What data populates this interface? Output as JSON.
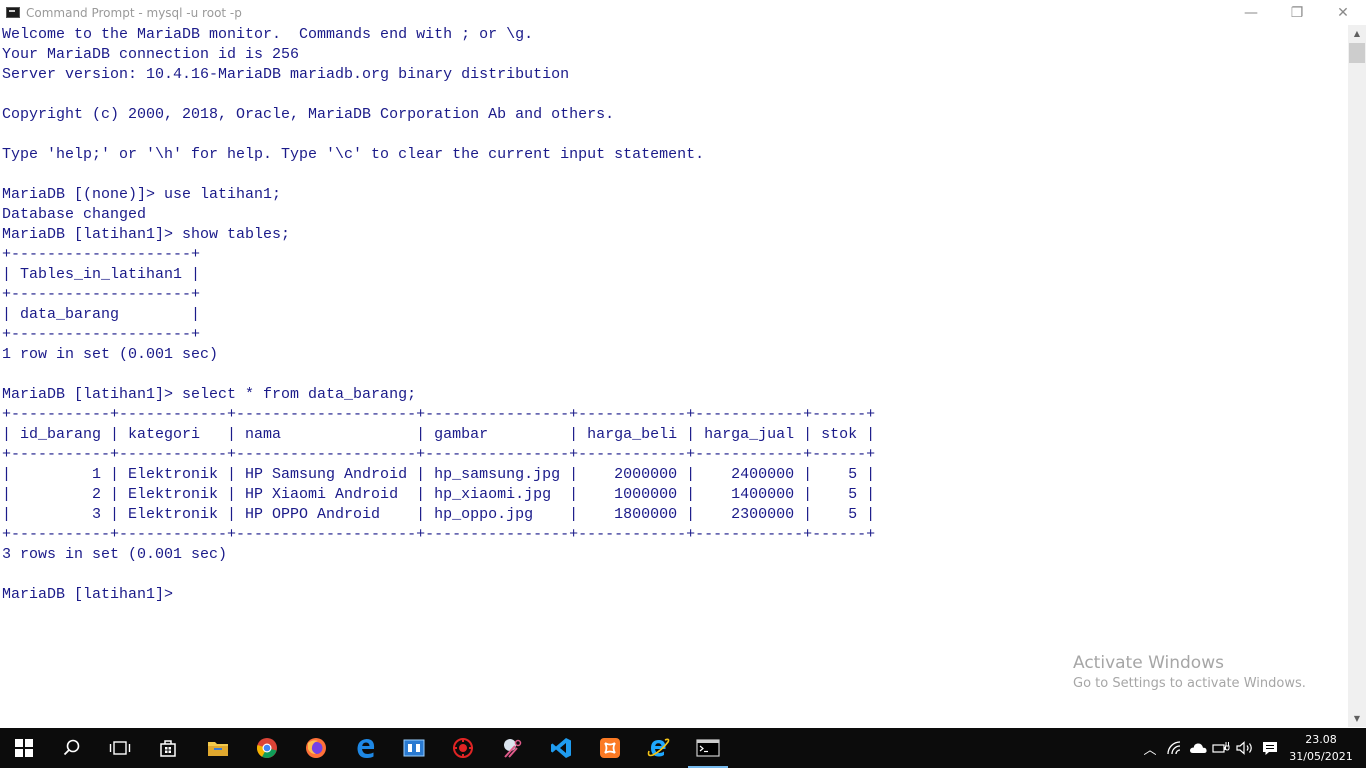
{
  "window": {
    "title": "Command Prompt - mysql  -u root -p",
    "minimize_glyph": "—",
    "restore_glyph": "❐",
    "close_glyph": "✕"
  },
  "console": {
    "lines": [
      "Welcome to the MariaDB monitor.  Commands end with ; or \\g.",
      "Your MariaDB connection id is 256",
      "Server version: 10.4.16-MariaDB mariadb.org binary distribution",
      "",
      "Copyright (c) 2000, 2018, Oracle, MariaDB Corporation Ab and others.",
      "",
      "Type 'help;' or '\\h' for help. Type '\\c' to clear the current input statement.",
      "",
      "MariaDB [(none)]> use latihan1;",
      "Database changed",
      "MariaDB [latihan1]> show tables;",
      "+--------------------+",
      "| Tables_in_latihan1 |",
      "+--------------------+",
      "| data_barang        |",
      "+--------------------+",
      "1 row in set (0.001 sec)",
      "",
      "MariaDB [latihan1]> select * from data_barang;",
      "+-----------+------------+--------------------+----------------+------------+------------+------+",
      "| id_barang | kategori   | nama               | gambar         | harga_beli | harga_jual | stok |",
      "+-----------+------------+--------------------+----------------+------------+------------+------+",
      "|         1 | Elektronik | HP Samsung Android | hp_samsung.jpg |    2000000 |    2400000 |    5 |",
      "|         2 | Elektronik | HP Xiaomi Android  | hp_xiaomi.jpg  |    1000000 |    1400000 |    5 |",
      "|         3 | Elektronik | HP OPPO Android    | hp_oppo.jpg    |    1800000 |    2300000 |    5 |",
      "+-----------+------------+--------------------+----------------+------------+------------+------+",
      "3 rows in set (0.001 sec)",
      "",
      "MariaDB [latihan1]>"
    ],
    "text_color": "#1b1b8a"
  },
  "scrollbar": {
    "up_glyph": "▲",
    "down_glyph": "▼"
  },
  "watermark": {
    "title": "Activate Windows",
    "subtitle": "Go to Settings to activate Windows."
  },
  "taskbar": {
    "items": [
      {
        "icon": "start-icon",
        "color": "#ffffff"
      },
      {
        "icon": "search-icon",
        "color": "#ffffff"
      },
      {
        "icon": "task-view-icon",
        "color": "#ffffff"
      },
      {
        "icon": "store-icon",
        "color": "#ffffff"
      },
      {
        "icon": "file-explorer-icon",
        "color": "#f2c94c"
      },
      {
        "icon": "chrome-icon",
        "color": "#34a853"
      },
      {
        "icon": "firefox-icon",
        "color": "#ff7139"
      },
      {
        "icon": "edge-icon",
        "color": "#1e88e5"
      },
      {
        "icon": "remote-app-icon",
        "color": "#3c8dde"
      },
      {
        "icon": "red-app-icon",
        "color": "#e02424"
      },
      {
        "icon": "snipping-icon",
        "color": "#e05a8a"
      },
      {
        "icon": "vscode-icon",
        "color": "#1f9cf0"
      },
      {
        "icon": "xampp-icon",
        "color": "#fb7a24"
      },
      {
        "icon": "ie-icon",
        "color": "#1ea7ff"
      },
      {
        "icon": "cmd-icon",
        "color": "#cccccc"
      }
    ],
    "tray": {
      "chevron_glyph": "︿",
      "clock_time": "23.08",
      "clock_date": "31/05/2021"
    }
  }
}
